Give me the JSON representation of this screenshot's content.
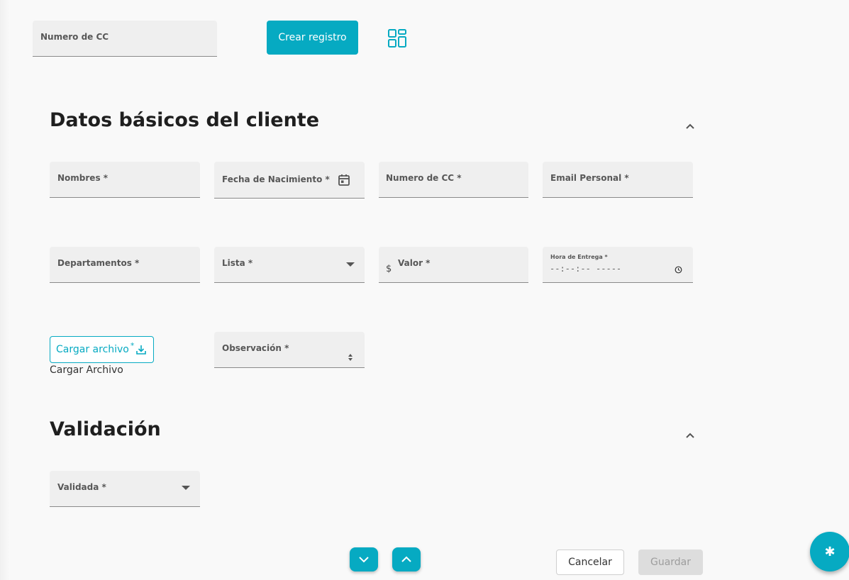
{
  "top": {
    "search_label": "Numero de CC",
    "create_button": "Crear registro",
    "layout_icon": "dashboard-layout-icon"
  },
  "sections": {
    "basic": {
      "title": "Datos básicos del cliente"
    },
    "validation": {
      "title": "Validación"
    }
  },
  "fields": {
    "nombres": "Nombres *",
    "fecha": "Fecha de Nacimiento *",
    "numero_cc": "Numero de CC *",
    "email": "Email Personal *",
    "departamentos": "Departamentos *",
    "lista": "Lista *",
    "valor": "Valor *",
    "valor_prefix": "$",
    "hora": "Hora de Entrega *",
    "hora_value": "--:--:-- -----",
    "observacion": "Observación *",
    "validada": "Validada *"
  },
  "upload": {
    "button": "Cargar archivo",
    "required_mark": "*",
    "caption": "Cargar Archivo"
  },
  "footer": {
    "cancel": "Cancelar",
    "save": "Guardar"
  },
  "fab": {
    "glyph": "✱"
  },
  "colors": {
    "accent": "#06aac2",
    "field_bg": "#efefef",
    "disabled_bg": "#dddddd"
  }
}
